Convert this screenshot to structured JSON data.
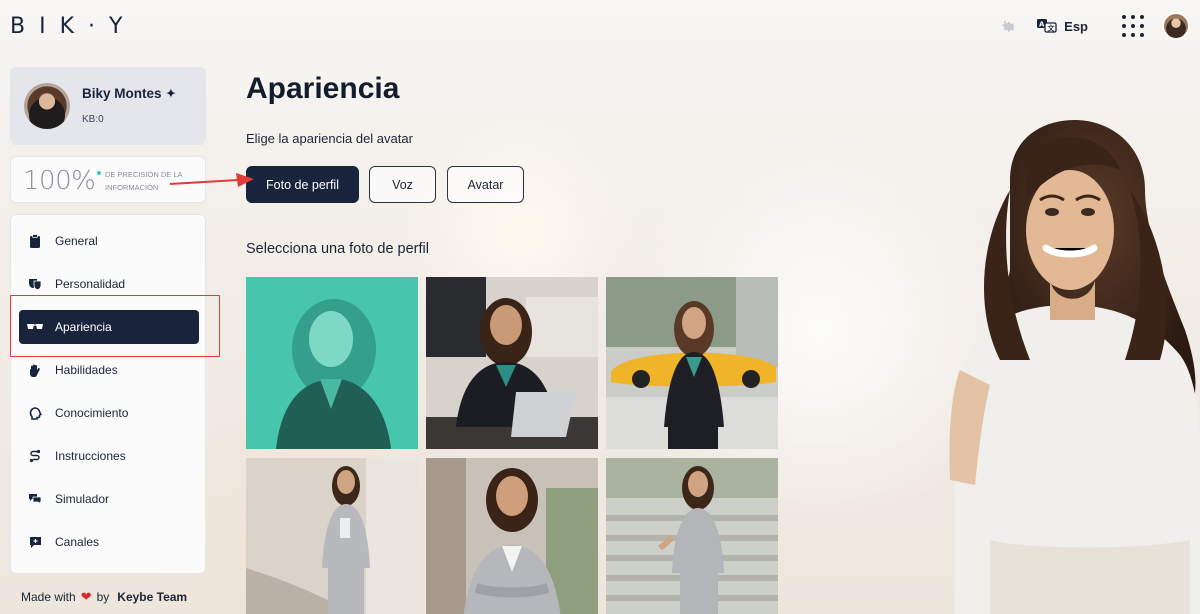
{
  "header": {
    "logo": "BIK·Y",
    "language": "Esp",
    "icons": [
      "gear-icon",
      "translate-icon",
      "apps-grid-icon",
      "user-avatar"
    ]
  },
  "sidebar": {
    "profile": {
      "name": "Biky Montes ✦",
      "kb": "KB:0"
    },
    "precision": {
      "value": "100%",
      "label": "DE PRECISIÓN DE LA INFORMACIÓN"
    },
    "items": [
      {
        "label": "General",
        "icon": "clipboard-icon"
      },
      {
        "label": "Personalidad",
        "icon": "masks-icon"
      },
      {
        "label": "Apariencia",
        "icon": "glasses-icon",
        "active": true
      },
      {
        "label": "Habilidades",
        "icon": "hand-icon"
      },
      {
        "label": "Conocimiento",
        "icon": "brain-icon"
      },
      {
        "label": "Instrucciones",
        "icon": "route-icon"
      },
      {
        "label": "Simulador",
        "icon": "chat-bubbles-icon"
      },
      {
        "label": "Canales",
        "icon": "chat-channel-icon"
      }
    ],
    "footer": {
      "made_with": "Made with",
      "by": "by",
      "team": "Keybe Team"
    }
  },
  "main": {
    "title": "Apariencia",
    "subtitle": "Elige la apariencia del avatar",
    "tabs": [
      {
        "label": "Foto de perfil",
        "active": true
      },
      {
        "label": "Voz",
        "active": false
      },
      {
        "label": "Avatar",
        "active": false
      }
    ],
    "section_title": "Selecciona una foto de perfil"
  },
  "colors": {
    "primary": "#17243c",
    "highlight": "#e03a3a",
    "accent_teal": "#3cc8b4",
    "heart": "#d92c2c"
  }
}
